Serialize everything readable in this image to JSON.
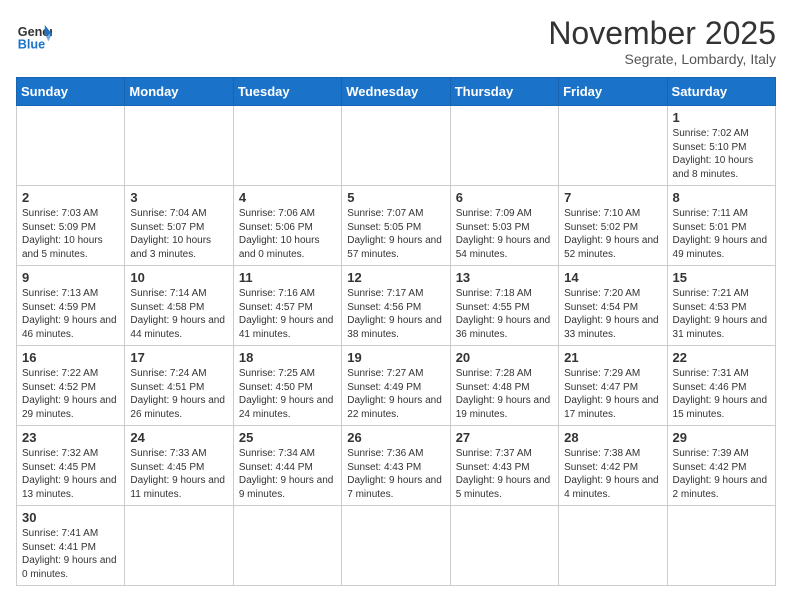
{
  "logo": {
    "general": "General",
    "blue": "Blue"
  },
  "header": {
    "month": "November 2025",
    "location": "Segrate, Lombardy, Italy"
  },
  "weekdays": [
    "Sunday",
    "Monday",
    "Tuesday",
    "Wednesday",
    "Thursday",
    "Friday",
    "Saturday"
  ],
  "weeks": [
    [
      {
        "day": "",
        "info": ""
      },
      {
        "day": "",
        "info": ""
      },
      {
        "day": "",
        "info": ""
      },
      {
        "day": "",
        "info": ""
      },
      {
        "day": "",
        "info": ""
      },
      {
        "day": "",
        "info": ""
      },
      {
        "day": "1",
        "info": "Sunrise: 7:02 AM\nSunset: 5:10 PM\nDaylight: 10 hours\nand 8 minutes."
      }
    ],
    [
      {
        "day": "2",
        "info": "Sunrise: 7:03 AM\nSunset: 5:09 PM\nDaylight: 10 hours\nand 5 minutes."
      },
      {
        "day": "3",
        "info": "Sunrise: 7:04 AM\nSunset: 5:07 PM\nDaylight: 10 hours\nand 3 minutes."
      },
      {
        "day": "4",
        "info": "Sunrise: 7:06 AM\nSunset: 5:06 PM\nDaylight: 10 hours\nand 0 minutes."
      },
      {
        "day": "5",
        "info": "Sunrise: 7:07 AM\nSunset: 5:05 PM\nDaylight: 9 hours\nand 57 minutes."
      },
      {
        "day": "6",
        "info": "Sunrise: 7:09 AM\nSunset: 5:03 PM\nDaylight: 9 hours\nand 54 minutes."
      },
      {
        "day": "7",
        "info": "Sunrise: 7:10 AM\nSunset: 5:02 PM\nDaylight: 9 hours\nand 52 minutes."
      },
      {
        "day": "8",
        "info": "Sunrise: 7:11 AM\nSunset: 5:01 PM\nDaylight: 9 hours\nand 49 minutes."
      }
    ],
    [
      {
        "day": "9",
        "info": "Sunrise: 7:13 AM\nSunset: 4:59 PM\nDaylight: 9 hours\nand 46 minutes."
      },
      {
        "day": "10",
        "info": "Sunrise: 7:14 AM\nSunset: 4:58 PM\nDaylight: 9 hours\nand 44 minutes."
      },
      {
        "day": "11",
        "info": "Sunrise: 7:16 AM\nSunset: 4:57 PM\nDaylight: 9 hours\nand 41 minutes."
      },
      {
        "day": "12",
        "info": "Sunrise: 7:17 AM\nSunset: 4:56 PM\nDaylight: 9 hours\nand 38 minutes."
      },
      {
        "day": "13",
        "info": "Sunrise: 7:18 AM\nSunset: 4:55 PM\nDaylight: 9 hours\nand 36 minutes."
      },
      {
        "day": "14",
        "info": "Sunrise: 7:20 AM\nSunset: 4:54 PM\nDaylight: 9 hours\nand 33 minutes."
      },
      {
        "day": "15",
        "info": "Sunrise: 7:21 AM\nSunset: 4:53 PM\nDaylight: 9 hours\nand 31 minutes."
      }
    ],
    [
      {
        "day": "16",
        "info": "Sunrise: 7:22 AM\nSunset: 4:52 PM\nDaylight: 9 hours\nand 29 minutes."
      },
      {
        "day": "17",
        "info": "Sunrise: 7:24 AM\nSunset: 4:51 PM\nDaylight: 9 hours\nand 26 minutes."
      },
      {
        "day": "18",
        "info": "Sunrise: 7:25 AM\nSunset: 4:50 PM\nDaylight: 9 hours\nand 24 minutes."
      },
      {
        "day": "19",
        "info": "Sunrise: 7:27 AM\nSunset: 4:49 PM\nDaylight: 9 hours\nand 22 minutes."
      },
      {
        "day": "20",
        "info": "Sunrise: 7:28 AM\nSunset: 4:48 PM\nDaylight: 9 hours\nand 19 minutes."
      },
      {
        "day": "21",
        "info": "Sunrise: 7:29 AM\nSunset: 4:47 PM\nDaylight: 9 hours\nand 17 minutes."
      },
      {
        "day": "22",
        "info": "Sunrise: 7:31 AM\nSunset: 4:46 PM\nDaylight: 9 hours\nand 15 minutes."
      }
    ],
    [
      {
        "day": "23",
        "info": "Sunrise: 7:32 AM\nSunset: 4:45 PM\nDaylight: 9 hours\nand 13 minutes."
      },
      {
        "day": "24",
        "info": "Sunrise: 7:33 AM\nSunset: 4:45 PM\nDaylight: 9 hours\nand 11 minutes."
      },
      {
        "day": "25",
        "info": "Sunrise: 7:34 AM\nSunset: 4:44 PM\nDaylight: 9 hours\nand 9 minutes."
      },
      {
        "day": "26",
        "info": "Sunrise: 7:36 AM\nSunset: 4:43 PM\nDaylight: 9 hours\nand 7 minutes."
      },
      {
        "day": "27",
        "info": "Sunrise: 7:37 AM\nSunset: 4:43 PM\nDaylight: 9 hours\nand 5 minutes."
      },
      {
        "day": "28",
        "info": "Sunrise: 7:38 AM\nSunset: 4:42 PM\nDaylight: 9 hours\nand 4 minutes."
      },
      {
        "day": "29",
        "info": "Sunrise: 7:39 AM\nSunset: 4:42 PM\nDaylight: 9 hours\nand 2 minutes."
      }
    ],
    [
      {
        "day": "30",
        "info": "Sunrise: 7:41 AM\nSunset: 4:41 PM\nDaylight: 9 hours\nand 0 minutes."
      },
      {
        "day": "",
        "info": ""
      },
      {
        "day": "",
        "info": ""
      },
      {
        "day": "",
        "info": ""
      },
      {
        "day": "",
        "info": ""
      },
      {
        "day": "",
        "info": ""
      },
      {
        "day": "",
        "info": ""
      }
    ]
  ]
}
